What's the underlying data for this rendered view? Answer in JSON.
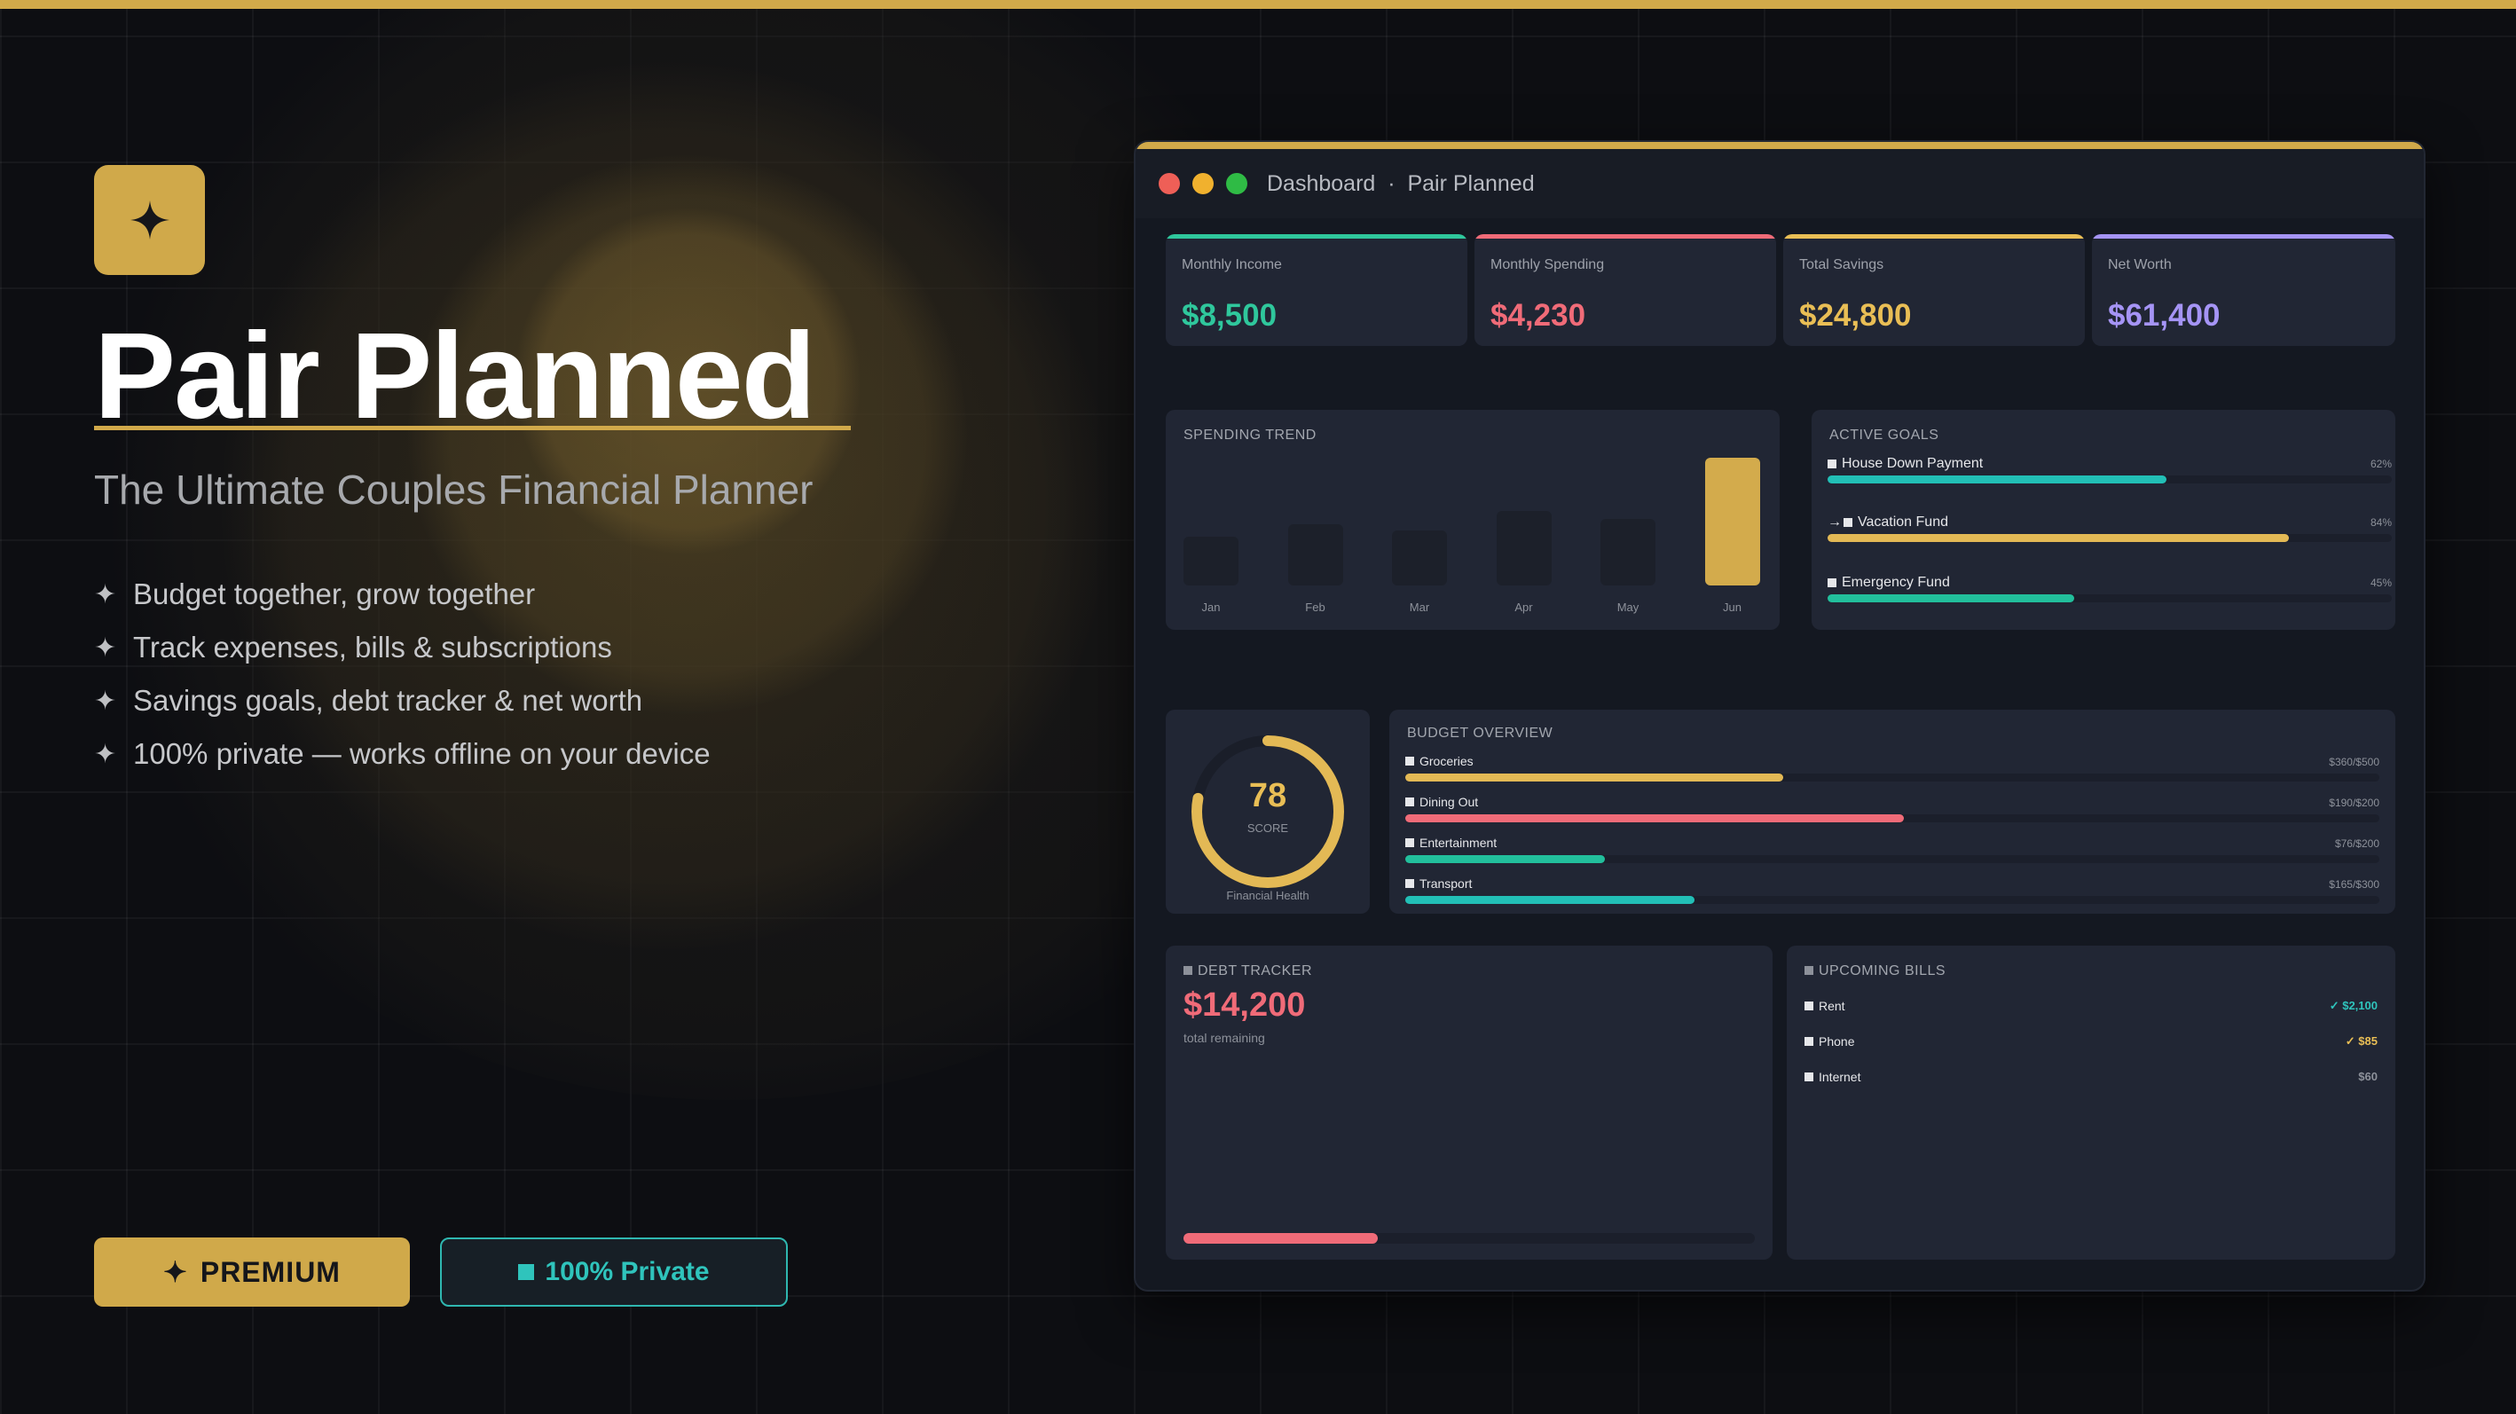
{
  "brand": {
    "title": "Pair Planned",
    "subtitle": "The Ultimate Couples Financial Planner",
    "accent_color": "#d1a94a"
  },
  "features": [
    "Budget together, grow together",
    "Track expenses, bills & subscriptions",
    "Savings goals, debt tracker & net worth",
    "100% private — works offline on your device"
  ],
  "badges": {
    "premium_label": "PREMIUM",
    "private_label": "100% Private"
  },
  "window": {
    "title": "Dashboard",
    "separator": "·",
    "app_name": "Pair Planned",
    "controls": {
      "close": "#ee5f57",
      "minimize": "#f0b12e",
      "maximize": "#2fbb45"
    }
  },
  "stats": [
    {
      "label": "Monthly Income",
      "value": "$8,500",
      "color": "#2fc79c"
    },
    {
      "label": "Monthly Spending",
      "value": "$4,230",
      "color": "#f06b78"
    },
    {
      "label": "Total Savings",
      "value": "$24,800",
      "color": "#e9be55"
    },
    {
      "label": "Net Worth",
      "value": "$61,400",
      "color": "#a594f5"
    }
  ],
  "spending_trend": {
    "title": "SPENDING TREND",
    "chart_data": {
      "type": "bar",
      "categories": [
        "Jan",
        "Feb",
        "Mar",
        "Apr",
        "May",
        "Jun"
      ],
      "values": [
        38,
        48,
        43,
        58,
        52,
        100
      ],
      "highlight": "Jun",
      "ylim": [
        0,
        100
      ]
    }
  },
  "active_goals": {
    "title": "ACTIVE GOALS",
    "items": [
      {
        "name": "House Down Payment",
        "pct_label": "62%",
        "progress": 0.6,
        "color": "#22bfb6",
        "prefix": ""
      },
      {
        "name": "Vacation Fund",
        "pct_label": "84%",
        "progress": 0.818,
        "color": "#e3b955",
        "prefix": "→"
      },
      {
        "name": "Emergency Fund",
        "pct_label": "45%",
        "progress": 0.437,
        "color": "#22bf9c",
        "prefix": ""
      }
    ]
  },
  "health": {
    "score": "78",
    "score_label": "SCORE",
    "caption": "Financial Health",
    "progress": 0.78
  },
  "budget_overview": {
    "title": "BUDGET OVERVIEW",
    "items": [
      {
        "name": "Groceries",
        "amount": "$360/$500",
        "progress": 0.388,
        "color": "#e3b955"
      },
      {
        "name": "Dining Out",
        "amount": "$190/$200",
        "progress": 0.512,
        "color": "#f06b78"
      },
      {
        "name": "Entertainment",
        "amount": "$76/$200",
        "progress": 0.205,
        "color": "#22bf9c"
      },
      {
        "name": "Transport",
        "amount": "$165/$300",
        "progress": 0.297,
        "color": "#22bfb6"
      }
    ]
  },
  "debt": {
    "title": "DEBT TRACKER",
    "amount": "$14,200",
    "caption": "total remaining",
    "progress": 0.34
  },
  "bills": {
    "title": "UPCOMING BILLS",
    "items": [
      {
        "name": "Rent",
        "amount": "✓ $2,100",
        "color": "#2fc4bc"
      },
      {
        "name": "Phone",
        "amount": "✓ $85",
        "color": "#e9be55"
      },
      {
        "name": "Internet",
        "amount": "$60",
        "color": "#8d919a"
      }
    ]
  }
}
